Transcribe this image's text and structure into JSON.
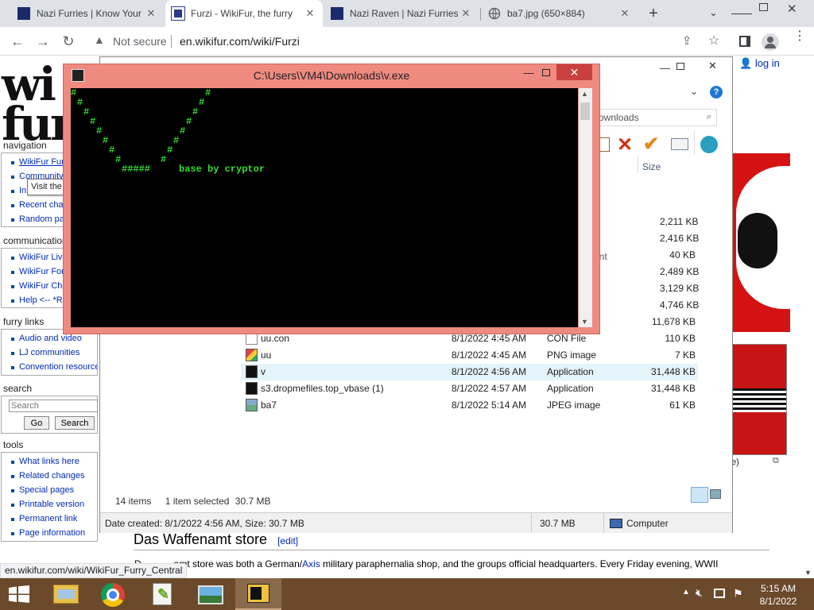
{
  "browser": {
    "tabs": [
      {
        "title": "Nazi Furries | Know Your"
      },
      {
        "title": "Furzi - WikiFur, the furry"
      },
      {
        "title": "Nazi Raven | Nazi Furries"
      },
      {
        "title": "ba7.jpg (650×884)"
      }
    ],
    "new_tab": "+",
    "security_label": "Not secure",
    "url": "en.wikifur.com/wiki/Furzi",
    "status_url": "en.wikifur.com/wiki/WikiFur_Furry_Central"
  },
  "wiki": {
    "login": "log in",
    "navigation_heading": "navigation",
    "navigation_items": [
      "WikiFur Furry Central",
      "Community portal",
      "In the news",
      "Recent changes",
      "Random page"
    ],
    "tooltip": "Visit the main page [alt-shift-z]",
    "communication_heading": "communication",
    "communication_items": [
      "WikiFur Live",
      "WikiFur Forum",
      "WikiFur Chat",
      "Help <-- *R"
    ],
    "furry_links_heading": "furry links",
    "furry_links_items": [
      "Audio and video",
      "LJ communities",
      "Convention resources"
    ],
    "search_heading": "search",
    "search_placeholder": "Search",
    "go_label": "Go",
    "search_label": "Search",
    "tools_heading": "tools",
    "tools_items": [
      "What links here",
      "Related changes",
      "Special pages",
      "Printable version",
      "Permanent link",
      "Page information"
    ],
    "section_title": "Das Waffenamt store",
    "edit_label": "[edit]",
    "para_prefix": "D",
    "para_text": "amt store was both a German/",
    "para_link": "Axis",
    "para_rest": " military paraphernalia shop, and the groups official headquarters. Every Friday evening, WWII",
    "figure_caption": "e)"
  },
  "explorer": {
    "search_placeholder": "ownloads",
    "size_header": "Size",
    "partial_type": "ent",
    "files": [
      {
        "name": "",
        "date": "",
        "type": "",
        "size": "2,211 KB"
      },
      {
        "name": "",
        "date": "",
        "type": "",
        "size": "2,416 KB"
      },
      {
        "name": "",
        "date": "",
        "type": "",
        "size": "40 KB"
      },
      {
        "name": "",
        "date": "",
        "type": "",
        "size": "2,489 KB"
      },
      {
        "name": "",
        "date": "",
        "type": "",
        "size": "3,129 KB"
      },
      {
        "name": "",
        "date": "",
        "type": "",
        "size": "4,746 KB"
      },
      {
        "name": "",
        "date": "",
        "type": "",
        "size": "11,678 KB"
      },
      {
        "name": "uu.con",
        "date": "8/1/2022 4:45 AM",
        "type": "CON File",
        "size": "110 KB"
      },
      {
        "name": "uu",
        "date": "8/1/2022 4:45 AM",
        "type": "PNG image",
        "size": "7 KB"
      },
      {
        "name": "v",
        "date": "8/1/2022 4:56 AM",
        "type": "Application",
        "size": "31,448 KB"
      },
      {
        "name": "s3.dropmefiles.top_vbase (1)",
        "date": "8/1/2022 4:57 AM",
        "type": "Application",
        "size": "31,448 KB"
      },
      {
        "name": "ba7",
        "date": "8/1/2022 5:14 AM",
        "type": "JPEG image",
        "size": "61 KB"
      }
    ],
    "item_count": "14 items",
    "selected_info": "1 item selected",
    "selected_size": "30.7 MB",
    "details": "Date created: 8/1/2022 4:56 AM, Size: 30.7 MB",
    "details_size": "30.7 MB",
    "location": "Computer"
  },
  "console": {
    "title": "C:\\Users\\VM4\\Downloads\\v.exe",
    "bottom_hashes": "#####",
    "banner": "base by cryptor"
  },
  "taskbar": {
    "time": "5:15 AM",
    "date": "8/1/2022"
  }
}
